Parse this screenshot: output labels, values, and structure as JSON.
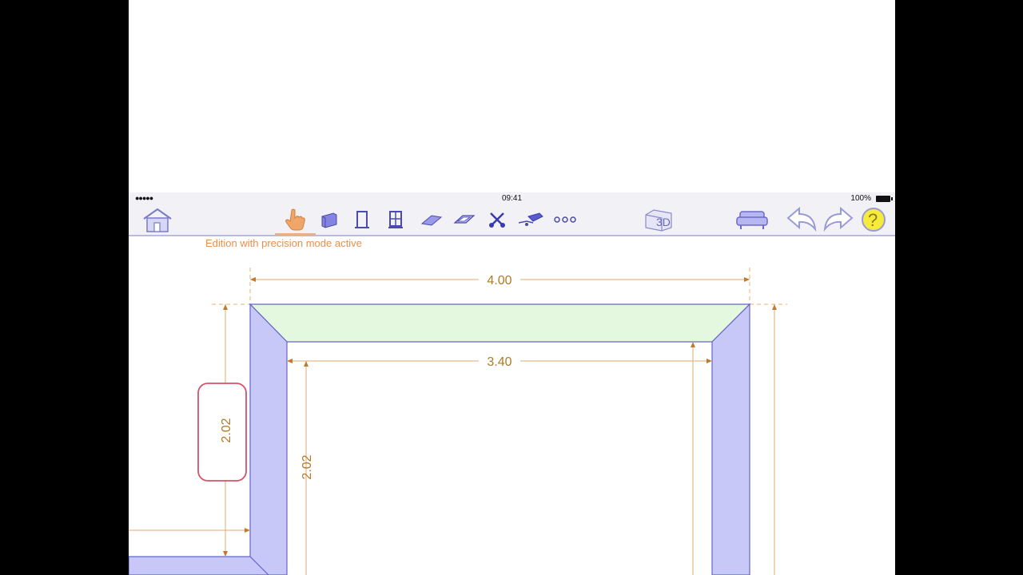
{
  "status_bar": {
    "signal": "●●●●● ",
    "time": "09:41",
    "battery": "100%"
  },
  "toolbar": {
    "tools": [
      {
        "name": "home-icon"
      },
      {
        "name": "hand-pointer-icon",
        "active": true
      },
      {
        "name": "wall-icon"
      },
      {
        "name": "door-icon"
      },
      {
        "name": "window-icon"
      },
      {
        "name": "floor-icon"
      },
      {
        "name": "ceiling-icon"
      },
      {
        "name": "scissors-icon"
      },
      {
        "name": "camera-icon"
      },
      {
        "name": "more-icon"
      },
      {
        "name": "view-3d-icon",
        "label": "3D"
      },
      {
        "name": "furniture-sofa-icon"
      },
      {
        "name": "undo-icon"
      },
      {
        "name": "redo-icon"
      },
      {
        "name": "help-icon",
        "label": "?"
      }
    ]
  },
  "hint_message": "Edition with precision mode active",
  "dimensions": {
    "outer_width": "4.00",
    "inner_width": "3.40",
    "left_height_selected": "2.02",
    "inner_height": "2.02"
  },
  "colors": {
    "wall_fill": "#c8c8f8",
    "wall_stroke": "#6464c8",
    "selected_wall_fill": "#e4f8e0",
    "dimension_color": "#b07a28",
    "selection_box": "#d8506a",
    "hint_color": "#e8904a"
  }
}
